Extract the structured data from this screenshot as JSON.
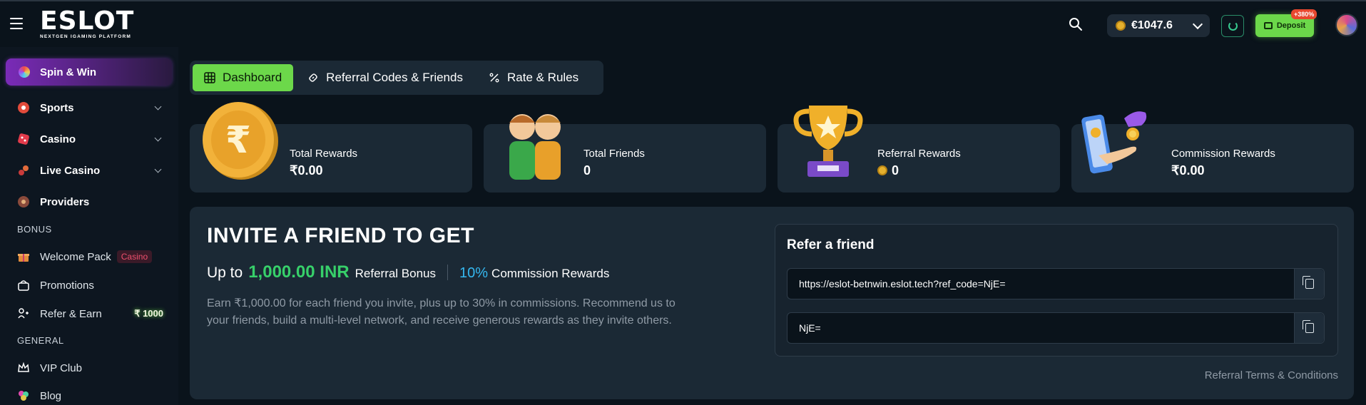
{
  "header": {
    "logo_text": "ESLOT",
    "logo_tagline": "NEXTGEN IGAMING PLATFORM",
    "wallet_amount": "€1047.6",
    "deposit_label": "Deposit",
    "deposit_badge": "+380%"
  },
  "sidebar": {
    "featured": {
      "label": "Spin & Win",
      "icon": "wheel-icon"
    },
    "nav": [
      {
        "label": "Sports",
        "icon": "sports-icon",
        "expandable": true
      },
      {
        "label": "Casino",
        "icon": "dice-icon",
        "expandable": true
      },
      {
        "label": "Live Casino",
        "icon": "live-casino-icon",
        "expandable": true
      },
      {
        "label": "Providers",
        "icon": "providers-icon",
        "expandable": false
      }
    ],
    "bonus_section": "BONUS",
    "bonus_items": [
      {
        "label": "Welcome Pack",
        "badge": "Casino",
        "icon": "gift-icon"
      },
      {
        "label": "Promotions",
        "icon": "promo-icon"
      },
      {
        "label": "Refer & Earn",
        "badge": "₹ 1000",
        "icon": "refer-icon"
      }
    ],
    "general_section": "GENERAL",
    "general_items": [
      {
        "label": "VIP Club",
        "icon": "crown-icon"
      },
      {
        "label": "Blog",
        "icon": "blog-icon"
      }
    ]
  },
  "tabs": [
    {
      "label": "Dashboard",
      "icon": "grid-icon",
      "active": true
    },
    {
      "label": "Referral Codes & Friends",
      "icon": "link-icon",
      "active": false
    },
    {
      "label": "Rate & Rules",
      "icon": "percent-icon",
      "active": false
    }
  ],
  "stats": [
    {
      "label": "Total Rewards",
      "value": "₹0.00",
      "graphic": "rupee-coin"
    },
    {
      "label": "Total Friends",
      "value": "0",
      "graphic": "friends"
    },
    {
      "label": "Referral Rewards",
      "value": "0",
      "graphic": "trophy"
    },
    {
      "label": "Commission Rewards",
      "value": "₹0.00",
      "graphic": "hand-coin"
    }
  ],
  "invite": {
    "title": "INVITE A FRIEND TO GET",
    "upto": "Up to",
    "amount": "1,000.00 INR",
    "amount_tail": "Referral Bonus",
    "pct": "10%",
    "pct_tail": "Commission Rewards",
    "description": "Earn ₹1,000.00 for each friend you invite, plus up to 30% in commissions. Recommend us to your friends, build a multi-level network, and receive generous rewards as they invite others."
  },
  "refer": {
    "title": "Refer a friend",
    "link": "https://eslot-betnwin.eslot.tech?ref_code=NjE=",
    "code": "NjE="
  },
  "terms_link": "Referral Terms & Conditions",
  "colors": {
    "accent_green": "#6cd84a",
    "highlight_green": "#37d06a",
    "highlight_blue": "#35b8f0",
    "panel": "#1b2935"
  }
}
